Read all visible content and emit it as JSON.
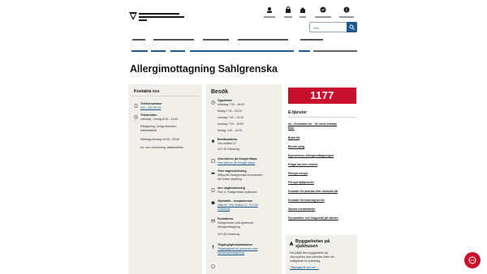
{
  "search": {
    "placeholder": "Sök"
  },
  "page": {
    "title": "Allergimottagning Sahlgrenska"
  },
  "contact": {
    "heading": "Kontakta oss",
    "phone_label": "Telefonnummer",
    "phone_number": "031 - 342 00 00",
    "phone_hours_label": "Telefontider",
    "phone_hours": "måndag - fredag 8:00 - 11:00",
    "advice1": "Rådgivning, övriga ärenden,",
    "advice2": "tidsbeställda",
    "weekend": "Måndag-söndag 00:00 - 23:59",
    "cancel": "Av- och ombokning, tidsbeställda"
  },
  "visit": {
    "heading": "Besök",
    "hours_label": "Öppettider",
    "hours": [
      "måndag 7:30 - 16:00",
      "tisdag 7:30 - 16:15",
      "onsdag 7:30 - 16:15",
      "torsdag 7:30 - 16:00",
      "fredag 7:30 - 14:00"
    ],
    "visit_addr_label": "Besöksadress",
    "visit_addr1": "Vita stråket 12",
    "visit_addr2": "413 46 Göteborg",
    "map_label": "Visa adress på Google Maps",
    "map_link": "Visa adress på Google Maps",
    "outer_label": "Yttre vägbeskrivning",
    "outer1": "Målpunkt Sahlgrenska Huvudentré,",
    "outer2": "där infarn skyltning",
    "inner_label": "Inre vägbeskrivning",
    "inner1": "Plan 0, Sahlgrenska sjukhuset",
    "traffic_label": "Västtrafik - reseplanerare",
    "traffic_link1": "Hitta till, Vita stråket 12, 413 46",
    "traffic_link2": "Göteborg",
    "post_label": "Postadress",
    "post1": "Sahlgrenska Univ.sjukhuset",
    "post2": "Allergimottagning",
    "post3": "413 45 Göteborg",
    "access_label": "Tillgänglighetsdatabasen",
    "access_link1": "Tillgänglighet för personer med",
    "access_link2": "funktionsnedsättning"
  },
  "right": {
    "banner": "1177",
    "eservices_heading": "E-tjänster",
    "links": [
      "Av- /Ombokas tid - Se mina bokade",
      "tider",
      "Boka tid",
      "Besök nylig",
      "Egenremiss Allergimottagningen",
      "Fråga om min remiss",
      "Förnya recept",
      "Förnya hjälpmedel",
      "Kontakt för avboka eller omboka tid",
      "Kontakt för bokning av tid",
      "Skicka meddelande",
      "Synpunkter och klagomål på vården"
    ]
  },
  "construction": {
    "title1": "Byggarbetan på",
    "title2": "sjukhusen",
    "lines": [
      "Det pågår flera byggarbeten på",
      "våra sjukhus som påverkar trafik och",
      "möjlighetan för parkering.",
      "Tillgänglig till nya och ..."
    ]
  },
  "colors": {
    "brand": "#c8102e",
    "link": "#1e5a8f",
    "panel": "#f1efea"
  },
  "icons": [
    "logo",
    "user-icon",
    "lock-icon",
    "home-icon",
    "settings-icon",
    "info-icon",
    "search-icon",
    "phone-icon",
    "clock-icon",
    "location-icon",
    "map-icon",
    "car-icon",
    "door-icon",
    "bus-icon",
    "mail-icon",
    "accessibility-icon",
    "chat-icon",
    "construction-icon"
  ]
}
